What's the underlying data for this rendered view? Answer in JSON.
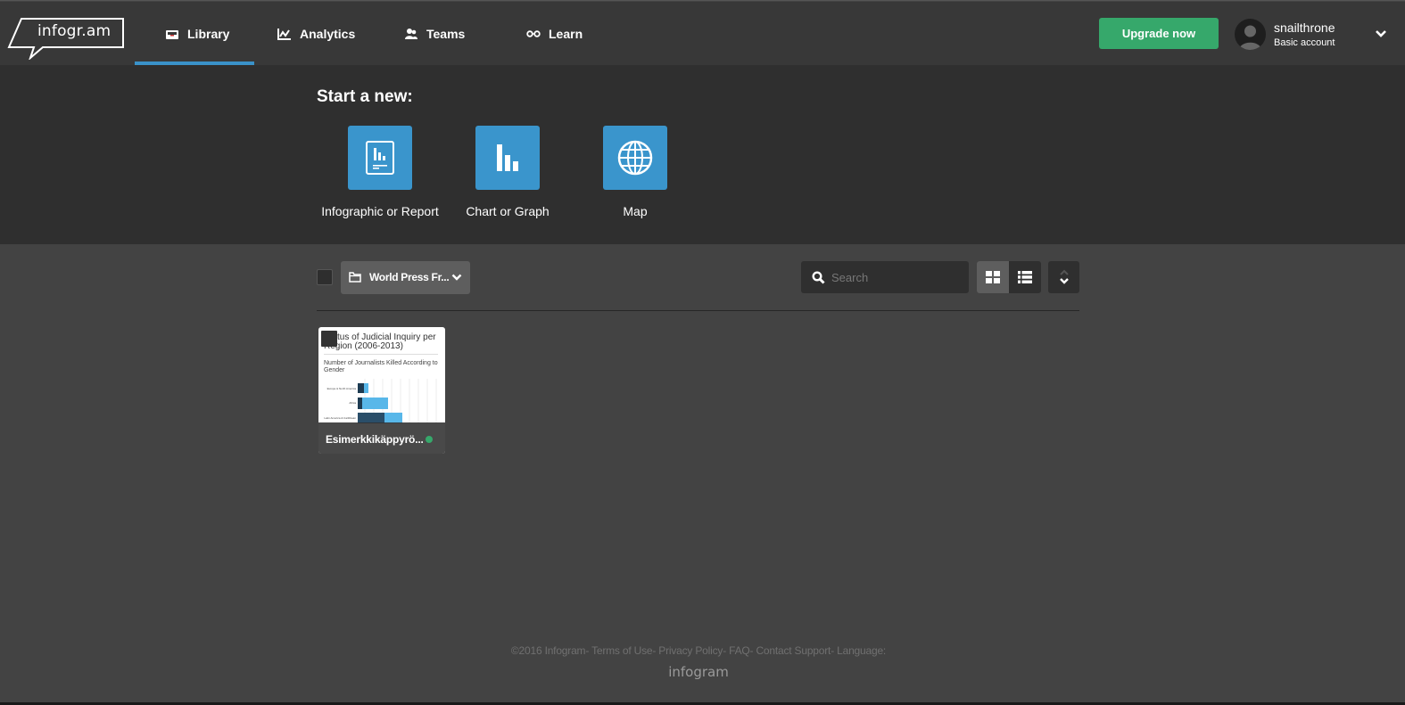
{
  "header": {
    "logo_text": "infogr.am",
    "nav": [
      {
        "label": "Library",
        "icon": "inbox-tray-icon",
        "active": true
      },
      {
        "label": "Analytics",
        "icon": "line-chart-icon",
        "active": false
      },
      {
        "label": "Teams",
        "icon": "users-icon",
        "active": false
      },
      {
        "label": "Learn",
        "icon": "glasses-icon",
        "active": false
      }
    ],
    "upgrade_label": "Upgrade now",
    "user": {
      "name": "snailthrone",
      "plan": "Basic account"
    }
  },
  "start": {
    "title": "Start a new:",
    "tiles": [
      {
        "label": "Infographic or Report",
        "icon": "report-icon"
      },
      {
        "label": "Chart or Graph",
        "icon": "bar-chart-icon"
      },
      {
        "label": "Map",
        "icon": "globe-icon"
      }
    ]
  },
  "toolbar": {
    "folder_label": "World Press Fr...",
    "search_placeholder": "Search",
    "view_mode": "grid"
  },
  "projects": [
    {
      "name": "Esimerkkikäppyrö...",
      "thumb_title": "Status of Judicial Inquiry per Region (2006-2013)",
      "thumb_subtitle": "Number of Journalists Killed According to Gender",
      "thumb_rows": [
        "Europe & North America",
        "Africa",
        "Latin America & Caribbean"
      ],
      "status": "published",
      "status_color": "#36a86b"
    }
  ],
  "footer": {
    "links": [
      "©2016 Infogram",
      "Terms of Use",
      "Privacy Policy",
      "FAQ",
      "Contact Support",
      "Language:"
    ],
    "brand": "infogram"
  },
  "colors": {
    "accent_blue": "#3a95cc",
    "upgrade_green": "#36a86b",
    "nav_bg": "#383838",
    "start_bg": "#2f2f2f",
    "page_bg": "#434343"
  }
}
